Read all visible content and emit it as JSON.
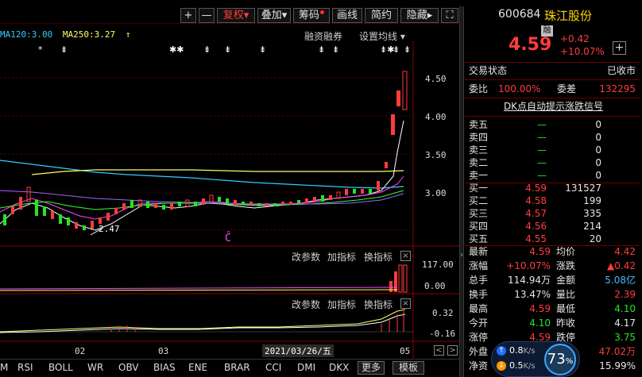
{
  "toolbar": {
    "plus": "+",
    "minus": "—",
    "fuquan": "复权",
    "fuquan_arrow": "▾",
    "diejia": "叠加",
    "diejia_arrow": "▾",
    "chouma": "筹码",
    "huaxian": "画线",
    "jianyue": "简约",
    "yincang": "隐藏",
    "yincang_arrow": "▸",
    "fullscreen": "⛶"
  },
  "ma": {
    "ma120": "MA120:3.00",
    "ma250": "MA250:3.27",
    "arrow": "↑"
  },
  "chart_tools": {
    "rongzi": "融资融券",
    "setting": "设置均线",
    "setting_arrow": "▾"
  },
  "markers": [
    "*",
    "⇟",
    "✱✱",
    "⇟",
    "⇟",
    "⇟",
    "⇟",
    "⇟",
    "⇟✱",
    "⇟",
    "⇟"
  ],
  "price_axis": [
    "4.50",
    "4.00",
    "3.50",
    "3.00"
  ],
  "low_label": "2.47",
  "c_mark": "Ĉ",
  "sub1": {
    "gai": "改参数",
    "jia": "加指标",
    "huan": "换指标",
    "close": "×",
    "axis_top": "117.00",
    "axis_bottom": "0.00"
  },
  "sub2": {
    "gai": "改参数",
    "jia": "加指标",
    "huan": "换指标",
    "close": "×",
    "axis_top": "0.32",
    "axis_bottom": "-0.16"
  },
  "x_axis": {
    "m1": "02",
    "m2": "03",
    "date": "2021/03/26/五",
    "m3": "05"
  },
  "scroll": {
    "left": "<",
    "right": ">"
  },
  "indicators": [
    "M",
    "RSI",
    "BOLL",
    "WR",
    "OBV",
    "BIAS",
    "ENE",
    "BRAR",
    "CCI",
    "DMI",
    "DKX"
  ],
  "ind_buttons": {
    "more": "更多",
    "template": "模板"
  },
  "quote": {
    "code": "600684",
    "name": "珠江股份",
    "badge": "融",
    "price": "4.59",
    "change": "+0.42",
    "change_pct": "+10.07%",
    "add": "+",
    "status_label": "交易状态",
    "status_value": "已收市",
    "weibi_label": "委比",
    "weibi_value": "100.00%",
    "weicha_label": "委差",
    "weicha_value": "132295",
    "dk_signal": "DK点自动提示涨跌信号",
    "sells": [
      {
        "label": "卖五",
        "price": "—",
        "vol": "0"
      },
      {
        "label": "卖四",
        "price": "—",
        "vol": "0"
      },
      {
        "label": "卖三",
        "price": "—",
        "vol": "0"
      },
      {
        "label": "卖二",
        "price": "—",
        "vol": "0"
      },
      {
        "label": "卖一",
        "price": "—",
        "vol": "0"
      }
    ],
    "buys": [
      {
        "label": "买一",
        "price": "4.59",
        "vol": "131527"
      },
      {
        "label": "买二",
        "price": "4.58",
        "vol": "199"
      },
      {
        "label": "买三",
        "price": "4.57",
        "vol": "335"
      },
      {
        "label": "买四",
        "price": "4.56",
        "vol": "214"
      },
      {
        "label": "买五",
        "price": "4.55",
        "vol": "20"
      }
    ],
    "stats": [
      {
        "l1": "最新",
        "v1": "4.59",
        "c1": "red",
        "l2": "均价",
        "v2": "4.42",
        "c2": "red"
      },
      {
        "l1": "涨幅",
        "v1": "+10.07%",
        "c1": "red",
        "l2": "涨跌",
        "v2": "▲0.42",
        "c2": "red"
      },
      {
        "l1": "总手",
        "v1": "114.94万",
        "c1": "white",
        "l2": "金额",
        "v2": "5.08亿",
        "c2": "cyan"
      },
      {
        "l1": "换手",
        "v1": "13.47%",
        "c1": "white",
        "l2": "量比",
        "v2": "2.39",
        "c2": "red"
      },
      {
        "l1": "最高",
        "v1": "4.59",
        "c1": "red",
        "l2": "最低",
        "v2": "4.10",
        "c2": "green"
      },
      {
        "l1": "今开",
        "v1": "4.10",
        "c1": "green",
        "l2": "昨收",
        "v2": "4.17",
        "c2": "white"
      },
      {
        "l1": "涨停",
        "v1": "4.59",
        "c1": "red",
        "l2": "跌停",
        "v2": "3.75",
        "c2": "green"
      },
      {
        "l1": "外盘",
        "v1": "",
        "c1": "red",
        "l2": "",
        "v2": "47.02万",
        "c2": "red"
      },
      {
        "l1": "净资",
        "v1": "",
        "c1": "white",
        "l2": "",
        "v2": "15.99%",
        "c2": "white"
      }
    ]
  },
  "widget": {
    "up": "0.8",
    "up_unit": "K/s",
    "down": "0.5",
    "down_unit": "K/s",
    "percent": "73",
    "percent_sign": "%"
  },
  "colors": {
    "up": "#ff3c3c",
    "down": "#22e622",
    "ma_yellow": "#ffff66",
    "ma_white": "#ffffff",
    "ma_magenta": "#ff44ff",
    "ma_green": "#33ff33",
    "ma_cyan": "#33ccff"
  }
}
